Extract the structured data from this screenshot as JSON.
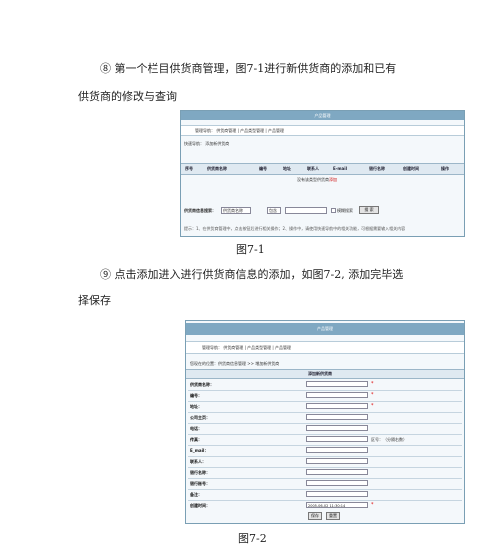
{
  "paragraph1": {
    "line1": "⑧  第一个栏目供货商管理，图7-1进行新供货商的添加和已有",
    "line2": "供货商的修改与查询"
  },
  "figure1": {
    "title": "产品管理",
    "nav": "管理导航：  供货商管理  |  产品类型管理  |  产品管理",
    "quick_nav": "快速导航：  添加新供货商",
    "columns": [
      "序号",
      "供货商名称",
      "编号",
      "地址",
      "联系人",
      "E-mail",
      "银行名称",
      "创建时间",
      "操作"
    ],
    "empty_text": "没有该类型供货商",
    "empty_link": "添加",
    "search_label": "供货商信息搜索：",
    "search_select1": "供货商名称",
    "search_select2": "包含",
    "search_checkbox": "模糊搜索",
    "search_button": "搜 索",
    "tip": "提示：1、在供货商管理中，点击按钮后进行相关操作；2、操作中，请使用快速导航中的相关功能，可根据需要输入相关内容"
  },
  "caption1": "图7-1",
  "paragraph2": {
    "line1": "⑨  点击添加进入进行供货商信息的添加，如图7-2, 添加完毕选",
    "line2": "择保存"
  },
  "figure2": {
    "title": "产品管理",
    "nav": "管理导航：  供货商管理  |  产品类型管理  |  产品管理",
    "breadcrumb": "您现在的位置：供货商信息管理  >>  增加新供货商",
    "section_title": "添加新供货商",
    "rows": [
      {
        "label": "供货商名称：",
        "value": "",
        "required": true,
        "note": ""
      },
      {
        "label": "编号：",
        "value": "",
        "required": true,
        "note": ""
      },
      {
        "label": "地址：",
        "value": "",
        "required": true,
        "note": ""
      },
      {
        "label": "公司主页：",
        "value": "",
        "required": false,
        "note": ""
      },
      {
        "label": "电话：",
        "value": "",
        "required": false,
        "note": ""
      },
      {
        "label": "传真：",
        "value": "",
        "required": false,
        "note": "区号：（分隔右数）"
      },
      {
        "label": "E_mail：",
        "value": "",
        "required": false,
        "note": ""
      },
      {
        "label": "联系人：",
        "value": "",
        "required": false,
        "note": ""
      },
      {
        "label": "银行名称：",
        "value": "",
        "required": false,
        "note": ""
      },
      {
        "label": "银行账号：",
        "value": "",
        "required": false,
        "note": ""
      },
      {
        "label": "备注：",
        "value": "",
        "required": false,
        "note": ""
      },
      {
        "label": "创建时间：",
        "value": "2005-06-02 11:30:14",
        "required": true,
        "note": ""
      }
    ],
    "save_button": "保存",
    "reset_button": "重置"
  },
  "caption2": "图7-2"
}
